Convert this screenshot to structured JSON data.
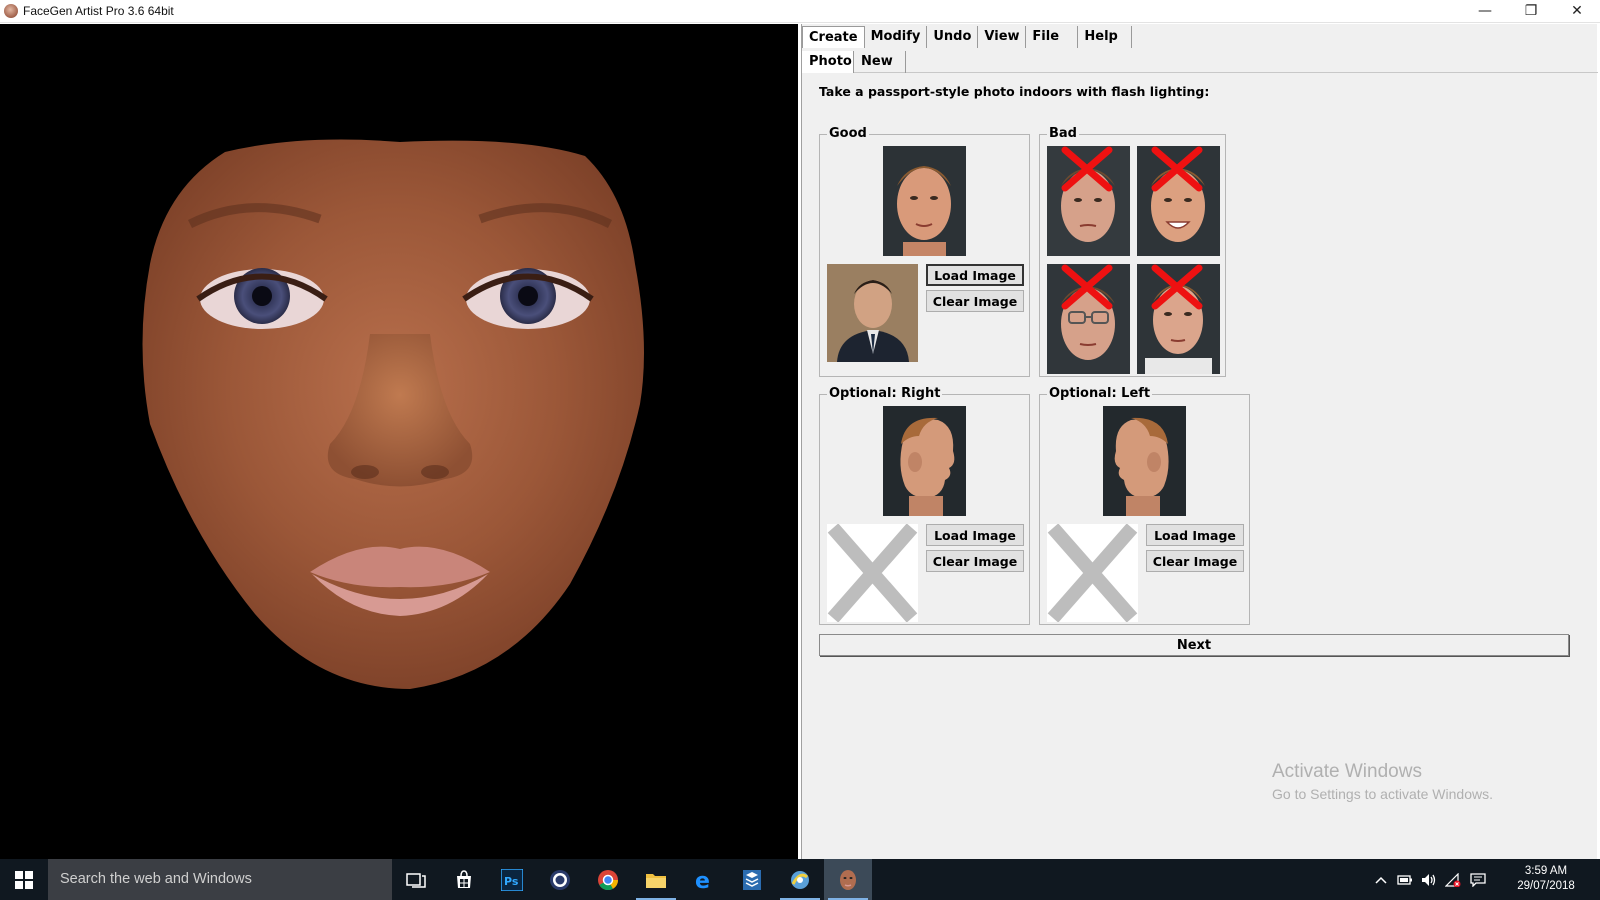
{
  "window": {
    "title": "FaceGen Artist Pro 3.6 64bit",
    "minimize": "—",
    "maximize": "❐",
    "close": "✕"
  },
  "menu": [
    "Create",
    "Modify",
    "Undo",
    "View",
    "File",
    "Help"
  ],
  "subtabs": [
    "Photo",
    "New"
  ],
  "instruction": "Take a passport-style photo indoors with flash lighting:",
  "groups": {
    "good": "Good",
    "bad": "Bad",
    "right": "Optional: Right",
    "left": "Optional: Left"
  },
  "buttons": {
    "load": "Load Image",
    "clear": "Clear Image",
    "next": "Next"
  },
  "watermark": {
    "title": "Activate Windows",
    "subtitle": "Go to Settings to activate Windows."
  },
  "taskbar": {
    "search_placeholder": "Search the web and Windows",
    "icons": [
      "task-view",
      "store",
      "photoshop",
      "cinema4d",
      "chrome",
      "file-explorer",
      "edge",
      "stack",
      "app",
      "facegen"
    ],
    "time": "3:59 AM",
    "date": "29/07/2018"
  },
  "colors": {
    "panel_bg": "#f0f0f0",
    "viewport_bg": "#000000",
    "taskbar_bg": "#101820",
    "bad_cross": "#ee1111"
  }
}
